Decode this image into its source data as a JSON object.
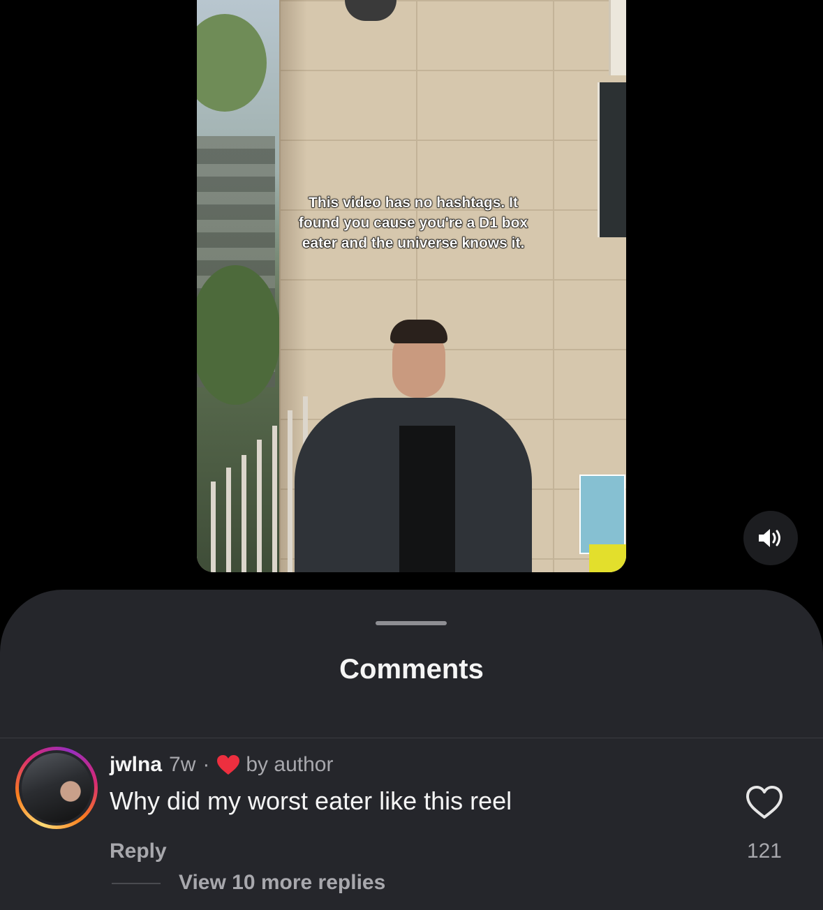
{
  "video": {
    "overlay_caption": "This video has no hashtags. It found you cause you're a D1 box eater and the universe knows it."
  },
  "sound_button": {
    "icon": "speaker-on-icon"
  },
  "comments_sheet": {
    "title": "Comments",
    "comments": [
      {
        "username": "jwlna",
        "time": "7w",
        "separator": "·",
        "liked_by_author_label": "by author",
        "text": "Why did my worst eater like this reel",
        "reply_label": "Reply",
        "like_count": "121",
        "view_replies_label": "View 10 more replies"
      }
    ]
  },
  "colors": {
    "background": "#000000",
    "sheet_background": "#25262b",
    "primary_text": "#f5f5f5",
    "secondary_text": "#a8a8ad",
    "author_heart": "#ed2f3f"
  }
}
